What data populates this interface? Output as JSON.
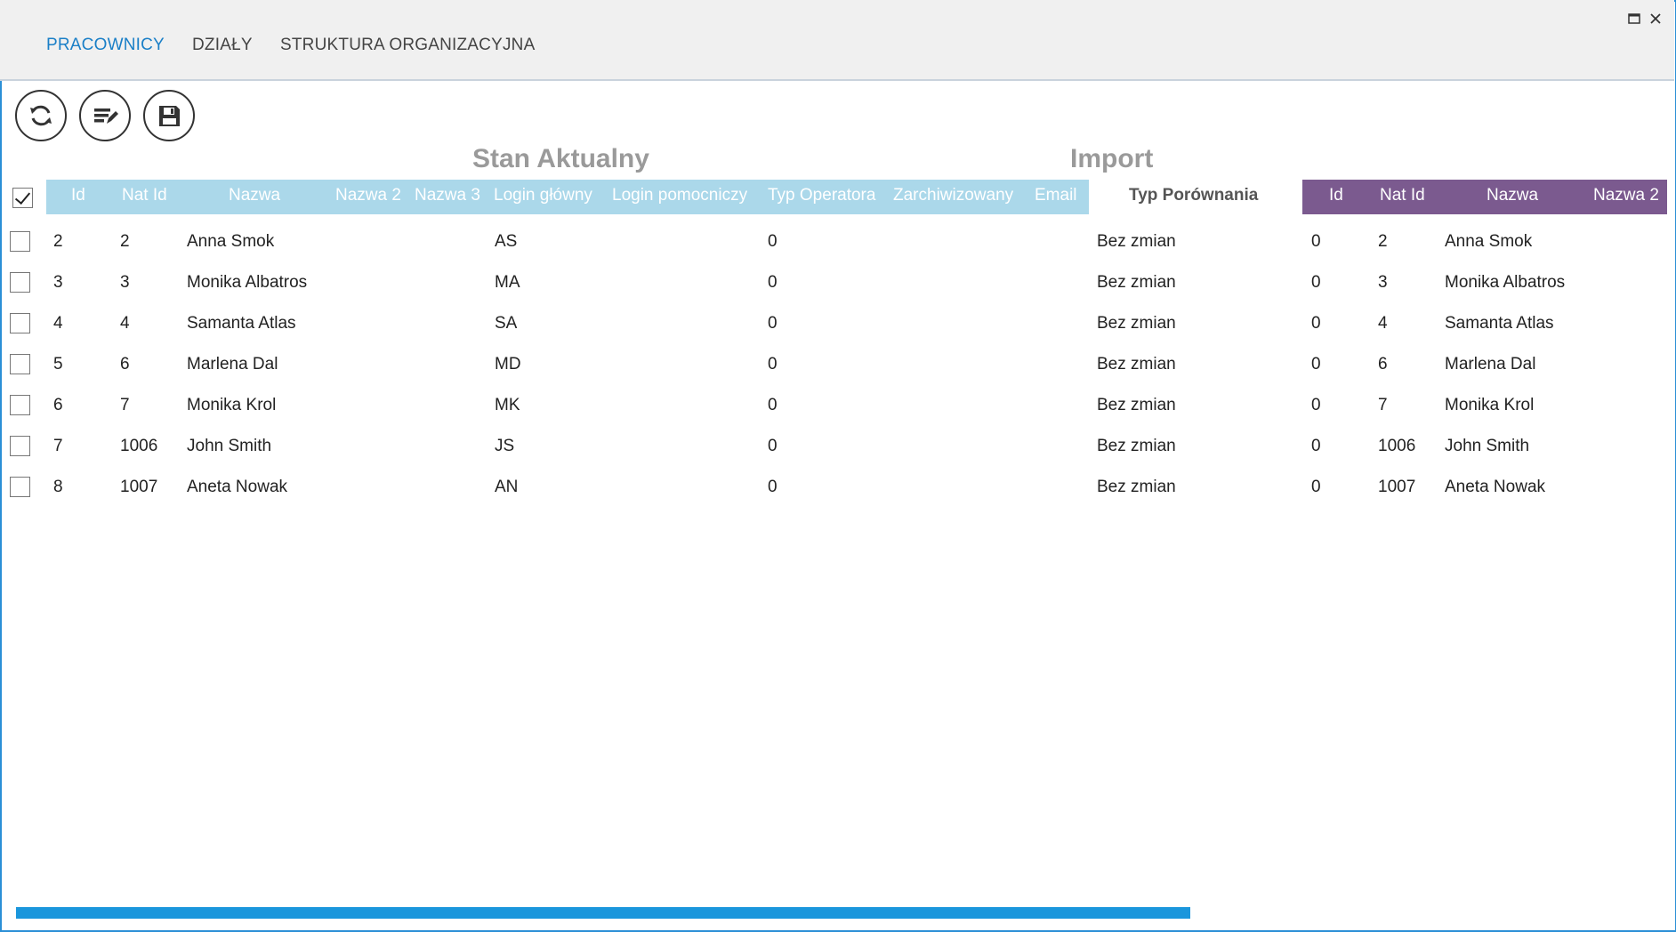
{
  "tabs": [
    {
      "label": "PRACOWNICY",
      "active": true
    },
    {
      "label": "DZIAŁY",
      "active": false
    },
    {
      "label": "STRUKTURA ORGANIZACYJNA",
      "active": false
    }
  ],
  "window": {
    "maximize_icon": "maximize-icon",
    "close_icon": "close-icon"
  },
  "toolbar": {
    "refresh_icon": "refresh-icon",
    "edit_icon": "edit-list-icon",
    "save_icon": "save-icon"
  },
  "sections": {
    "current_title": "Stan Aktualny",
    "import_title": "Import"
  },
  "current_headers": [
    "Id",
    "Nat Id",
    "Nazwa",
    "Nazwa 2",
    "Nazwa 3",
    "Login główny",
    "Login pomocniczy",
    "Typ Operatora",
    "Zarchiwizowany",
    "Email"
  ],
  "compare_header": "Typ Porównania",
  "import_headers": [
    "Id",
    "Nat Id",
    "Nazwa",
    "Nazwa 2"
  ],
  "rows": [
    {
      "checked": false,
      "id": "2",
      "nat_id": "2",
      "nazwa": "Anna Smok",
      "login": "AS",
      "typ_operatora": "0",
      "typ_porownania": "Bez zmian",
      "imp_id": "0",
      "imp_nat_id": "2",
      "imp_nazwa": "Anna Smok"
    },
    {
      "checked": false,
      "id": "3",
      "nat_id": "3",
      "nazwa": "Monika Albatros",
      "login": "MA",
      "typ_operatora": "0",
      "typ_porownania": "Bez zmian",
      "imp_id": "0",
      "imp_nat_id": "3",
      "imp_nazwa": "Monika Albatros"
    },
    {
      "checked": false,
      "id": "4",
      "nat_id": "4",
      "nazwa": "Samanta Atlas",
      "login": "SA",
      "typ_operatora": "0",
      "typ_porownania": "Bez zmian",
      "imp_id": "0",
      "imp_nat_id": "4",
      "imp_nazwa": "Samanta Atlas"
    },
    {
      "checked": false,
      "id": "5",
      "nat_id": "6",
      "nazwa": "Marlena Dal",
      "login": "MD",
      "typ_operatora": "0",
      "typ_porownania": "Bez zmian",
      "imp_id": "0",
      "imp_nat_id": "6",
      "imp_nazwa": "Marlena Dal"
    },
    {
      "checked": false,
      "id": "6",
      "nat_id": "7",
      "nazwa": "Monika Krol",
      "login": "MK",
      "typ_operatora": "0",
      "typ_porownania": "Bez zmian",
      "imp_id": "0",
      "imp_nat_id": "7",
      "imp_nazwa": "Monika Krol"
    },
    {
      "checked": false,
      "id": "7",
      "nat_id": "1006",
      "nazwa": "John Smith",
      "login": "JS",
      "typ_operatora": "0",
      "typ_porownania": "Bez zmian",
      "imp_id": "0",
      "imp_nat_id": "1006",
      "imp_nazwa": "John Smith"
    },
    {
      "checked": false,
      "id": "8",
      "nat_id": "1007",
      "nazwa": "Aneta Nowak",
      "login": "AN",
      "typ_operatora": "0",
      "typ_porownania": "Bez zmian",
      "imp_id": "0",
      "imp_nat_id": "1007",
      "imp_nazwa": "Aneta Nowak"
    }
  ],
  "select_all_checked": true,
  "colors": {
    "accent": "#1a7fc7",
    "current_header_bg": "#abd8ea",
    "import_header_bg": "#7b5a8f",
    "progress": "#1a96dc"
  }
}
